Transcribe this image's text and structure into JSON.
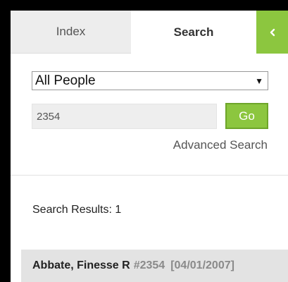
{
  "tabs": {
    "index_label": "Index",
    "search_label": "Search",
    "collapse_icon": "chevron-left-icon",
    "accent_color": "#8cc63f"
  },
  "search": {
    "scope_selected": "All People",
    "query_value": "2354",
    "go_label": "Go",
    "advanced_label": "Advanced Search"
  },
  "results": {
    "label": "Search Results: 1",
    "items": [
      {
        "name": "Abbate, Finesse R",
        "id": "#2354",
        "date": "[04/01/2007]"
      }
    ]
  }
}
